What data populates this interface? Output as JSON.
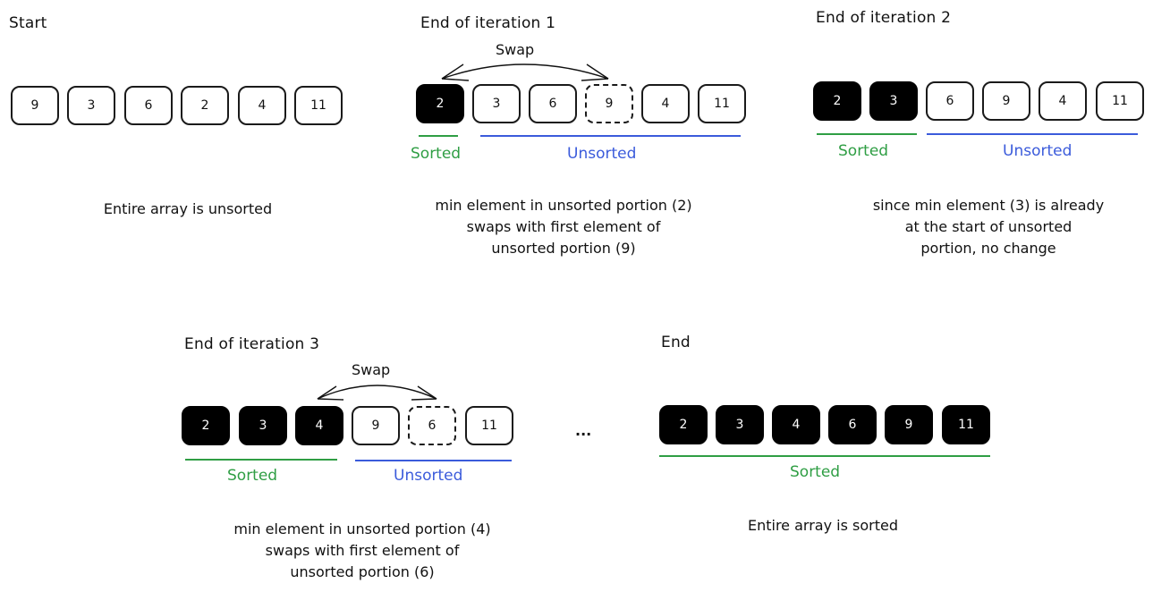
{
  "panels": {
    "start": {
      "title": "Start",
      "cells": [
        {
          "value": "9",
          "state": "unsorted"
        },
        {
          "value": "3",
          "state": "unsorted"
        },
        {
          "value": "6",
          "state": "unsorted"
        },
        {
          "value": "2",
          "state": "unsorted"
        },
        {
          "value": "4",
          "state": "unsorted"
        },
        {
          "value": "11",
          "state": "unsorted"
        }
      ],
      "note": "Entire array is unsorted"
    },
    "iter1": {
      "title": "End of iteration 1",
      "swap_label": "Swap",
      "cells": [
        {
          "value": "2",
          "state": "sorted"
        },
        {
          "value": "3",
          "state": "unsorted"
        },
        {
          "value": "6",
          "state": "unsorted"
        },
        {
          "value": "9",
          "state": "swapped"
        },
        {
          "value": "4",
          "state": "unsorted"
        },
        {
          "value": "11",
          "state": "unsorted"
        }
      ],
      "sorted_label": "Sorted",
      "unsorted_label": "Unsorted",
      "note": "min element in unsorted portion (2)\nswaps with first element of\nunsorted portion (9)"
    },
    "iter2": {
      "title": "End of iteration 2",
      "cells": [
        {
          "value": "2",
          "state": "sorted"
        },
        {
          "value": "3",
          "state": "sorted"
        },
        {
          "value": "6",
          "state": "unsorted"
        },
        {
          "value": "9",
          "state": "unsorted"
        },
        {
          "value": "4",
          "state": "unsorted"
        },
        {
          "value": "11",
          "state": "unsorted"
        }
      ],
      "sorted_label": "Sorted",
      "unsorted_label": "Unsorted",
      "note": "since min element (3) is already\nat the start of unsorted\nportion, no change"
    },
    "iter3": {
      "title": "End of iteration 3",
      "swap_label": "Swap",
      "cells": [
        {
          "value": "2",
          "state": "sorted"
        },
        {
          "value": "3",
          "state": "sorted"
        },
        {
          "value": "4",
          "state": "sorted"
        },
        {
          "value": "9",
          "state": "unsorted"
        },
        {
          "value": "6",
          "state": "swapped"
        },
        {
          "value": "11",
          "state": "unsorted"
        }
      ],
      "sorted_label": "Sorted",
      "unsorted_label": "Unsorted",
      "note": "min element in unsorted portion (4)\nswaps with first element of\nunsorted portion (6)"
    },
    "ellipsis": "...",
    "end": {
      "title": "End",
      "cells": [
        {
          "value": "2",
          "state": "sorted"
        },
        {
          "value": "3",
          "state": "sorted"
        },
        {
          "value": "4",
          "state": "sorted"
        },
        {
          "value": "6",
          "state": "sorted"
        },
        {
          "value": "9",
          "state": "sorted"
        },
        {
          "value": "11",
          "state": "sorted"
        }
      ],
      "sorted_label": "Sorted",
      "note": "Entire array is sorted"
    }
  },
  "colors": {
    "sorted": "#2f9e44",
    "unsorted": "#3b5bdb",
    "ink": "#111111"
  }
}
